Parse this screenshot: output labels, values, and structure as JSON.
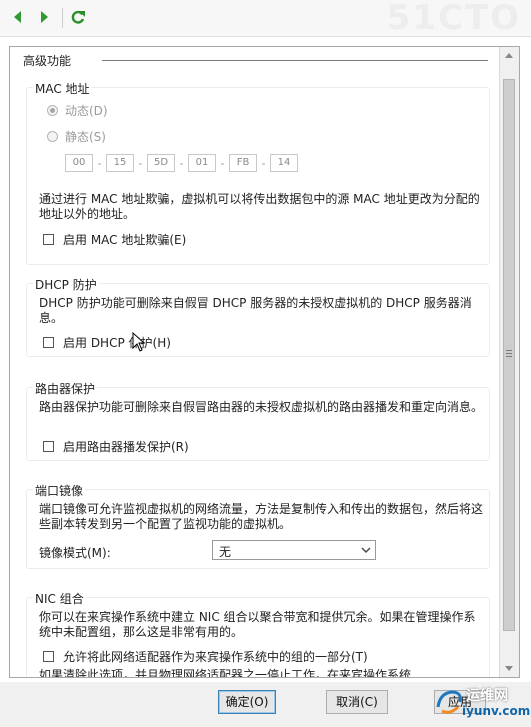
{
  "watermark": "51CTO",
  "toolbar": {
    "back_icon": "arrow-left-icon",
    "forward_icon": "arrow-right-icon",
    "refresh_icon": "refresh-icon",
    "colors": {
      "arrow": "#2f9a2f",
      "refresh": "#2b8f2b"
    }
  },
  "page": {
    "section_title": "高级功能",
    "mac": {
      "title": "MAC 地址",
      "dynamic_label": "动态(D)",
      "static_label": "静态(S)",
      "octets": [
        "00",
        "15",
        "5D",
        "01",
        "FB",
        "14"
      ],
      "description": "通过进行 MAC 地址欺骗，虚拟机可以将传出数据包中的源 MAC 地址更改为分配的地址以外的地址。",
      "spoofing_label": "启用 MAC 地址欺骗(E)"
    },
    "dhcp": {
      "title": "DHCP 防护",
      "description": "DHCP 防护功能可删除来自假冒 DHCP 服务器的未授权虚拟机的 DHCP 服务器消息。",
      "checkbox_label": "启用 DHCP 保护(H)"
    },
    "router": {
      "title": "路由器保护",
      "description": "路由器保护功能可删除来自假冒路由器的未授权虚拟机的路由器播发和重定向消息。",
      "checkbox_label": "启用路由器播发保护(R)"
    },
    "mirror": {
      "title": "端口镜像",
      "description": "端口镜像可允许监视虚拟机的网络流量，方法是复制传入和传出的数据包，然后将这些副本转发到另一个配置了监视功能的虚拟机。",
      "mode_label": "镜像模式(M):",
      "mode_value": "无"
    },
    "nic": {
      "title": "NIC 组合",
      "description": "你可以在来宾操作系统中建立 NIC 组合以聚合带宽和提供冗余。如果在管理操作系统中未配置组，那么这是非常有用的。",
      "checkbox_label": "允许将此网络适配器作为来宾操作系统中的组的一部分(T)",
      "trailing_text": "如果清除此选项，并且物理网络适配器之一停止工作，在来宾操作系统"
    }
  },
  "footer": {
    "ok_label": "确定(O)",
    "cancel_label": "取消(C)",
    "apply_label": "应用"
  },
  "logo": {
    "name": "运维网",
    "domain": "iyunv.com"
  }
}
